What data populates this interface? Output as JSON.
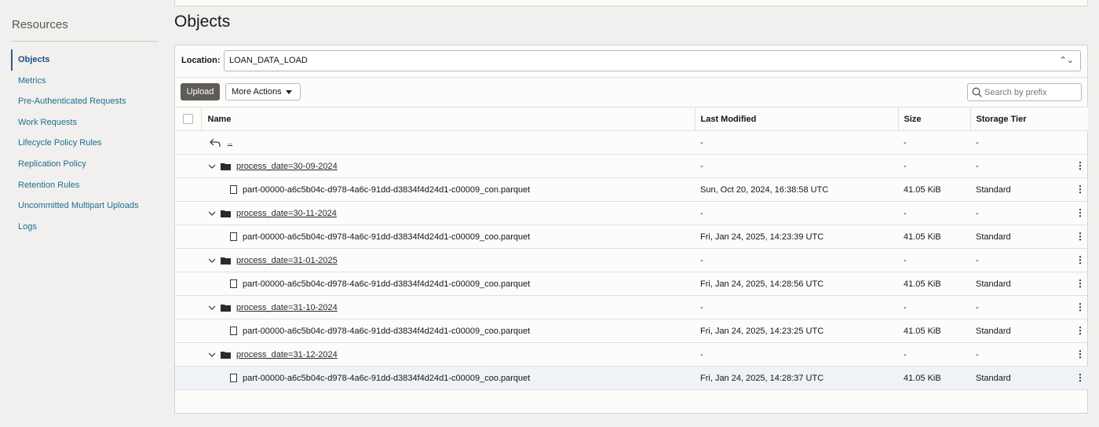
{
  "sidebar": {
    "title": "Resources",
    "items": [
      {
        "label": "Objects",
        "active": true
      },
      {
        "label": "Metrics"
      },
      {
        "label": "Pre-Authenticated Requests"
      },
      {
        "label": "Work Requests"
      },
      {
        "label": "Lifecycle Policy Rules"
      },
      {
        "label": "Replication Policy"
      },
      {
        "label": "Retention Rules"
      },
      {
        "label": "Uncommitted Multipart Uploads"
      },
      {
        "label": "Logs"
      }
    ]
  },
  "main": {
    "title": "Objects",
    "location_label": "Location:",
    "location_value": "LOAN_DATA_LOAD",
    "upload_label": "Upload",
    "more_actions_label": "More Actions",
    "search_placeholder": "Search by prefix",
    "columns": [
      "Name",
      "Last Modified",
      "Size",
      "Storage Tier"
    ],
    "parent_row": {
      "name": "..",
      "modified": "-",
      "size": "-",
      "tier": "-"
    },
    "rows": [
      {
        "type": "folder",
        "name": "process_date=30-09-2024",
        "modified": "-",
        "size": "-",
        "tier": "-"
      },
      {
        "type": "file",
        "name": "part-00000-a6c5b04c-d978-4a6c-91dd-d3834f4d24d1-c00009_con.parquet",
        "modified": "Sun, Oct 20, 2024, 16:38:58 UTC",
        "size": "41.05 KiB",
        "tier": "Standard"
      },
      {
        "type": "folder",
        "name": "process_date=30-11-2024",
        "modified": "-",
        "size": "-",
        "tier": "-"
      },
      {
        "type": "file",
        "name": "part-00000-a6c5b04c-d978-4a6c-91dd-d3834f4d24d1-c00009_coo.parquet",
        "modified": "Fri, Jan 24, 2025, 14:23:39 UTC",
        "size": "41.05 KiB",
        "tier": "Standard"
      },
      {
        "type": "folder",
        "name": "process_date=31-01-2025",
        "modified": "-",
        "size": "-",
        "tier": "-"
      },
      {
        "type": "file",
        "name": "part-00000-a6c5b04c-d978-4a6c-91dd-d3834f4d24d1-c00009_coo.parquet",
        "modified": "Fri, Jan 24, 2025, 14:28:56 UTC",
        "size": "41.05 KiB",
        "tier": "Standard"
      },
      {
        "type": "folder",
        "name": "process_date=31-10-2024",
        "modified": "-",
        "size": "-",
        "tier": "-"
      },
      {
        "type": "file",
        "name": "part-00000-a6c5b04c-d978-4a6c-91dd-d3834f4d24d1-c00009_coo.parquet",
        "modified": "Fri, Jan 24, 2025, 14:23:25 UTC",
        "size": "41.05 KiB",
        "tier": "Standard"
      },
      {
        "type": "folder",
        "name": "process_date=31-12-2024",
        "modified": "-",
        "size": "-",
        "tier": "-"
      },
      {
        "type": "file",
        "name": "part-00000-a6c5b04c-d978-4a6c-91dd-d3834f4d24d1-c00009_coo.parquet",
        "modified": "Fri, Jan 24, 2025, 14:28:37 UTC",
        "size": "41.05 KiB",
        "tier": "Standard",
        "highlighted": true
      }
    ]
  }
}
